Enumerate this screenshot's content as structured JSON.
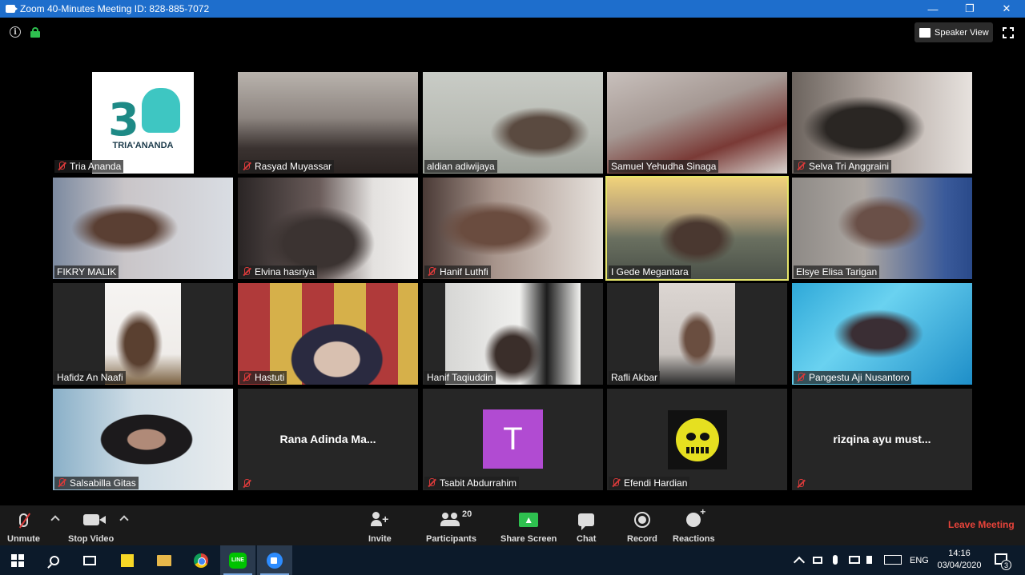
{
  "window": {
    "title": "Zoom 40-Minutes Meeting ID: 828-885-7072",
    "controls": [
      "—",
      "❐",
      "✕"
    ]
  },
  "topbar": {
    "speaker_view_label": "Speaker View"
  },
  "participants": [
    {
      "name": "Tria Ananda",
      "muted": true,
      "logo_text": "TRIA'ANANDA",
      "logo_digit": "3"
    },
    {
      "name": "Rasyad Muyassar",
      "muted": true
    },
    {
      "name": "aldian adiwijaya",
      "muted": false
    },
    {
      "name": "Samuel Yehudha Sinaga",
      "muted": false
    },
    {
      "name": "Selva Tri Anggraini",
      "muted": true
    },
    {
      "name": "FIKRY MALIK",
      "muted": false
    },
    {
      "name": "Elvina hasriya",
      "muted": true
    },
    {
      "name": "Hanif Luthfi",
      "muted": true
    },
    {
      "name": "I Gede Megantara",
      "muted": false,
      "active_speaker": true
    },
    {
      "name": "Elsye Elisa Tarigan",
      "muted": false
    },
    {
      "name": "Hafidz An Naafi",
      "muted": false
    },
    {
      "name": "Hastuti",
      "muted": true
    },
    {
      "name": "Hanif Taqiuddin",
      "muted": false
    },
    {
      "name": "Rafli Akbar",
      "muted": false
    },
    {
      "name": "Pangestu Aji Nusantoro",
      "muted": true
    },
    {
      "name": "Salsabilla Gitas",
      "muted": true
    },
    {
      "name": "",
      "display_text": "Rana Adinda Ma...",
      "muted": true
    },
    {
      "name": "Tsabit Abdurrahim",
      "muted": true,
      "avatar_letter": "T",
      "avatar_color": "#b14bd2"
    },
    {
      "name": "Efendi Hardian",
      "muted": true,
      "avatar_icon": "skull-emblem-icon"
    },
    {
      "name": "",
      "display_text": "rizqina ayu must...",
      "muted": true
    }
  ],
  "controlbar": {
    "unmute_label": "Unmute",
    "stop_video_label": "Stop Video",
    "invite_label": "Invite",
    "participants_label": "Participants",
    "participants_count": "20",
    "share_screen_label": "Share Screen",
    "chat_label": "Chat",
    "record_label": "Record",
    "reactions_label": "Reactions",
    "leave_label": "Leave Meeting",
    "leave_color": "#e8433a",
    "share_color": "#2ec04f"
  },
  "taskbar": {
    "apps": [
      "windows-start-icon",
      "search-icon",
      "task-view-icon",
      "sticky-notes-icon",
      "file-explorer-icon",
      "chrome-icon",
      "line-icon",
      "zoom-icon"
    ],
    "line_label": "LINE",
    "language": "ENG",
    "time": "14:16",
    "date": "03/04/2020",
    "notification_count": "3"
  }
}
